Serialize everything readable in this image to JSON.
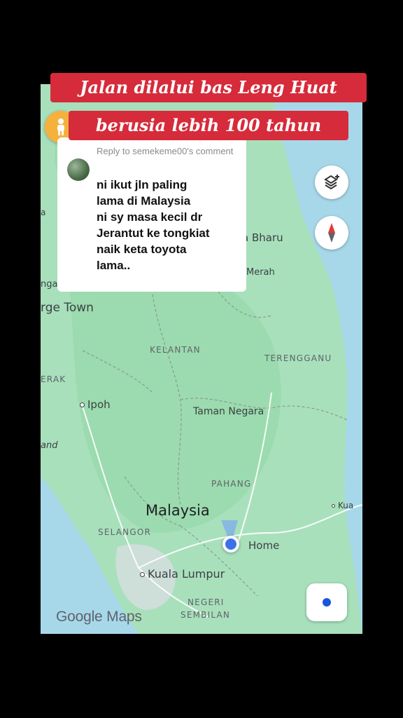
{
  "banner": {
    "line1": "Jalan dilalui bas Leng Huat",
    "line2": "berusia lebih 100 tahun"
  },
  "comment": {
    "reply_to": "Reply to semekeme00's comment",
    "text": "ni ikut jln paling\nlama di Malaysia\nni sy masa kecil dr\nJerantut ke tongkiat\nnaik keta toyota\nlama.."
  },
  "map": {
    "places": {
      "kota_bharu": "a Bharu",
      "merah": "Merah",
      "nga": "nga",
      "george_town": "rge Town",
      "kelantan": "KELANTAN",
      "terengganu": "TERENGGANU",
      "perak": "ERAK",
      "ipoh": "Ipoh",
      "taman_negara": "Taman Negara",
      "and": "and",
      "pahang": "PAHANG",
      "malaysia": "Malaysia",
      "kuantan": "Kua",
      "selangor": "SELANGOR",
      "home": "Home",
      "kuala_lumpur": "Kuala Lumpur",
      "negeri": "NEGERI",
      "sembilan": "SEMBILAN",
      "edge_a": "a"
    },
    "attribution": "Google Maps",
    "icons": [
      "pegman-icon",
      "layers-icon",
      "compass-icon",
      "my-location-icon"
    ],
    "colors": {
      "water": "#a7d8ea",
      "land": "#9fddb4",
      "banner": "#d62b3a",
      "location": "#3a73e8"
    }
  }
}
